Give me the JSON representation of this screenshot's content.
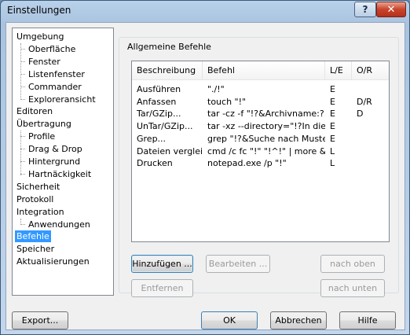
{
  "window": {
    "title": "Einstellungen",
    "help_label": "?",
    "close_label": "✕"
  },
  "tree": {
    "items": [
      {
        "label": "Umgebung",
        "level": 0
      },
      {
        "label": "Oberfläche",
        "level": 1
      },
      {
        "label": "Fenster",
        "level": 1
      },
      {
        "label": "Listenfenster",
        "level": 1
      },
      {
        "label": "Commander",
        "level": 1
      },
      {
        "label": "Exploreransicht",
        "level": 1
      },
      {
        "label": "Editoren",
        "level": 0
      },
      {
        "label": "Übertragung",
        "level": 0
      },
      {
        "label": "Profile",
        "level": 1
      },
      {
        "label": "Drag & Drop",
        "level": 1
      },
      {
        "label": "Hintergrund",
        "level": 1
      },
      {
        "label": "Hartnäckigkeit",
        "level": 1
      },
      {
        "label": "Sicherheit",
        "level": 0
      },
      {
        "label": "Protokoll",
        "level": 0
      },
      {
        "label": "Integration",
        "level": 0
      },
      {
        "label": "Anwendungen",
        "level": 1
      },
      {
        "label": "Befehle",
        "level": 0,
        "selected": true
      },
      {
        "label": "Speicher",
        "level": 0
      },
      {
        "label": "Aktualisierungen",
        "level": 0
      }
    ]
  },
  "group": {
    "label": "Allgemeine Befehle"
  },
  "table": {
    "columns": [
      "Beschreibung",
      "Befehl",
      "L/E",
      "O/R"
    ],
    "rows": [
      [
        "Ausführen",
        "\"./!\"",
        "E",
        ""
      ],
      [
        "Anfassen",
        "touch \"!\"",
        "E",
        "D/R"
      ],
      [
        "Tar/GZip...",
        "tar -cz  -f \"!?&Archivname:?...",
        "E",
        "D"
      ],
      [
        "UnTar/GZip...",
        "tar -xz --directory=\"!?In diese...",
        "E",
        ""
      ],
      [
        "Grep...",
        "grep \"!?&Suche nach Muste...",
        "E",
        ""
      ],
      [
        "Dateien verglei...",
        "cmd /c fc \"!\" \"!^!\" | more &&...",
        "L",
        ""
      ],
      [
        "Drucken",
        "notepad.exe /p \"!\"",
        "L",
        ""
      ]
    ]
  },
  "buttons": {
    "add": "Hinzufügen ...",
    "edit": "Bearbeiten ...",
    "up": "nach oben",
    "remove": "Entfernen",
    "down": "nach unten",
    "export": "Export...",
    "ok": "OK",
    "cancel": "Abbrechen",
    "help": "Hilfe"
  },
  "colors": {
    "selection": "#3399ff",
    "titlebar": "#b9d1ea",
    "close": "#c8432b"
  }
}
